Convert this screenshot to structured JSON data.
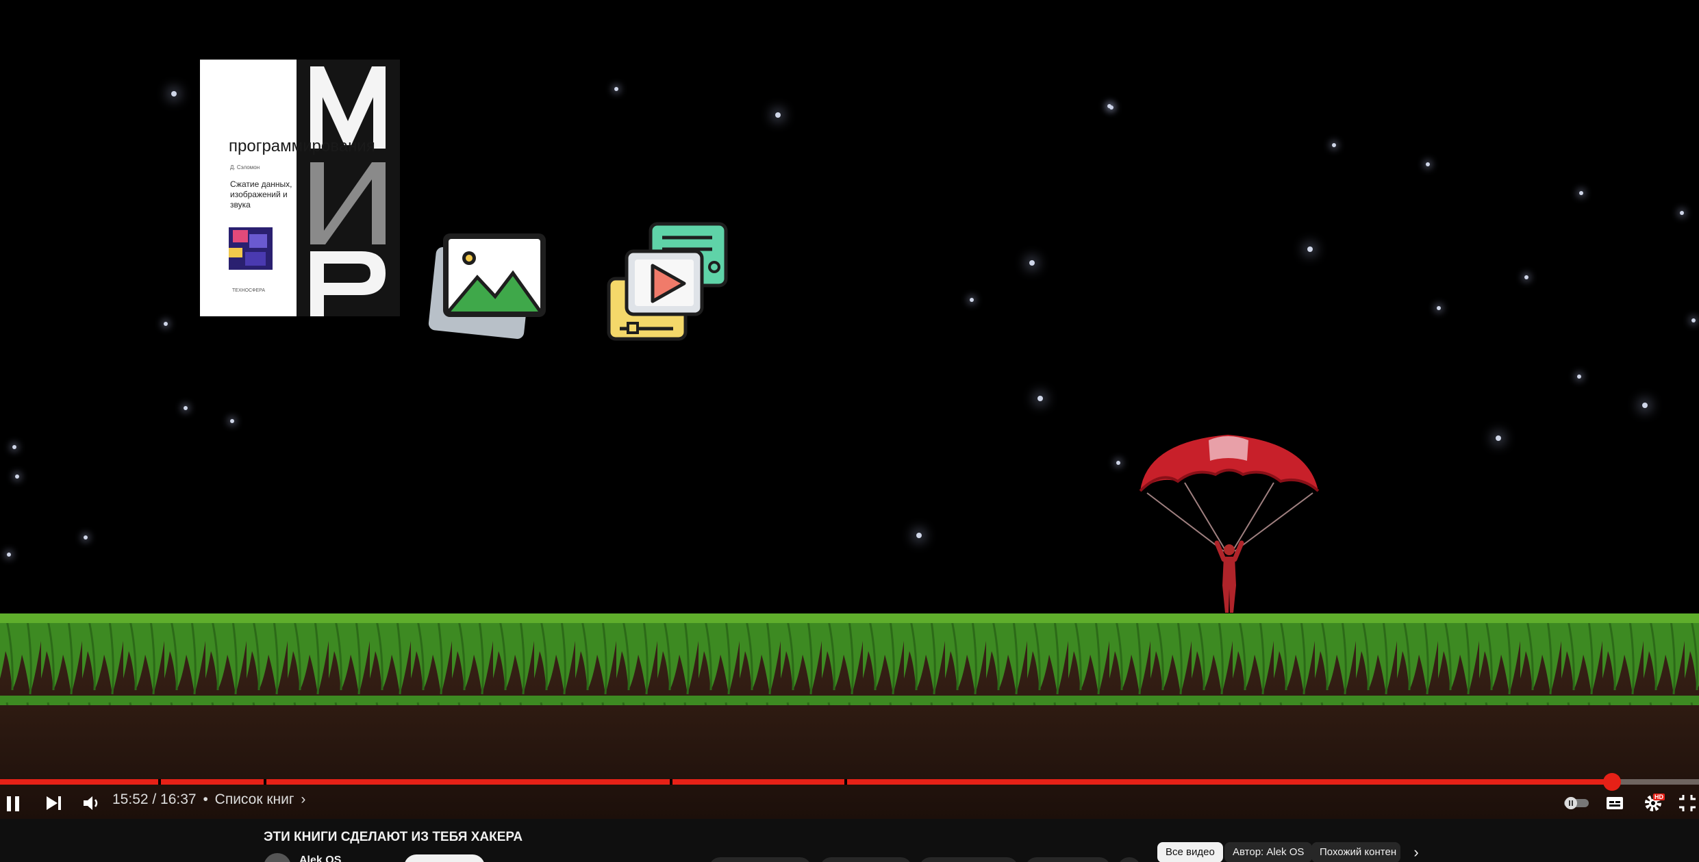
{
  "video": {
    "book": {
      "title": "программирования",
      "author": "Д. Сэломон",
      "subtitle": "Сжатие данных, изображений и звука",
      "publisher": "ТЕХНОСФЕРА"
    }
  },
  "player": {
    "progress_fraction": 0.949,
    "chapter_markers": [
      0.093,
      0.155,
      0.394,
      0.497
    ],
    "played_chapters_dim_until": 0.497,
    "time": "15:52 / 16:37",
    "chapter_sep": "•",
    "chapter_title": "Список книг",
    "chapter_chevron": "›",
    "hd_badge": "HD",
    "colors": {
      "progress": "#e62117",
      "hd": "#e62117"
    }
  },
  "below": {
    "title": "ЭТИ КНИГИ СДЕЛАЮТ ИЗ ТЕБЯ ХАКЕРА",
    "channel": "Alek OS",
    "chips": [
      "Все видео",
      "Автор: Alek OS",
      "Похожий контен"
    ]
  }
}
